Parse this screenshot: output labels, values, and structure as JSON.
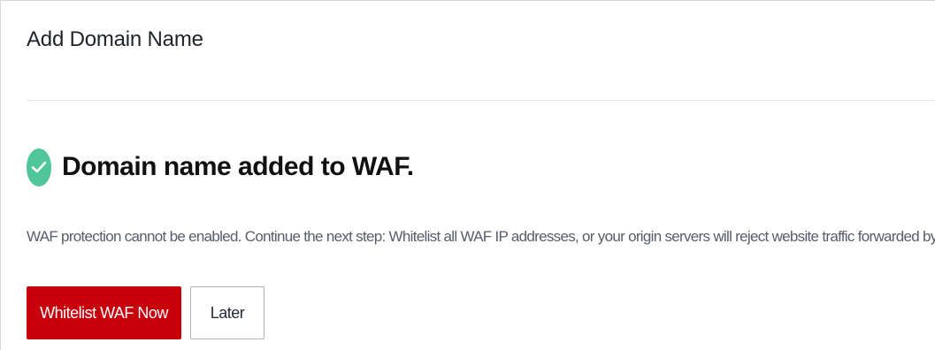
{
  "header": {
    "title": "Add Domain Name"
  },
  "result": {
    "icon": "check-circle-icon",
    "title": "Domain name added to WAF.",
    "message": "WAF protection cannot be enabled. Continue the next step: Whitelist all WAF IP addresses, or your origin servers will reject website traffic forwarded by WAF."
  },
  "actions": {
    "primary_label": "Whitelist WAF Now",
    "secondary_label": "Later"
  },
  "colors": {
    "brand_primary": "#c7000b",
    "success": "#4fc79a",
    "divider": "#e5e5e5"
  }
}
